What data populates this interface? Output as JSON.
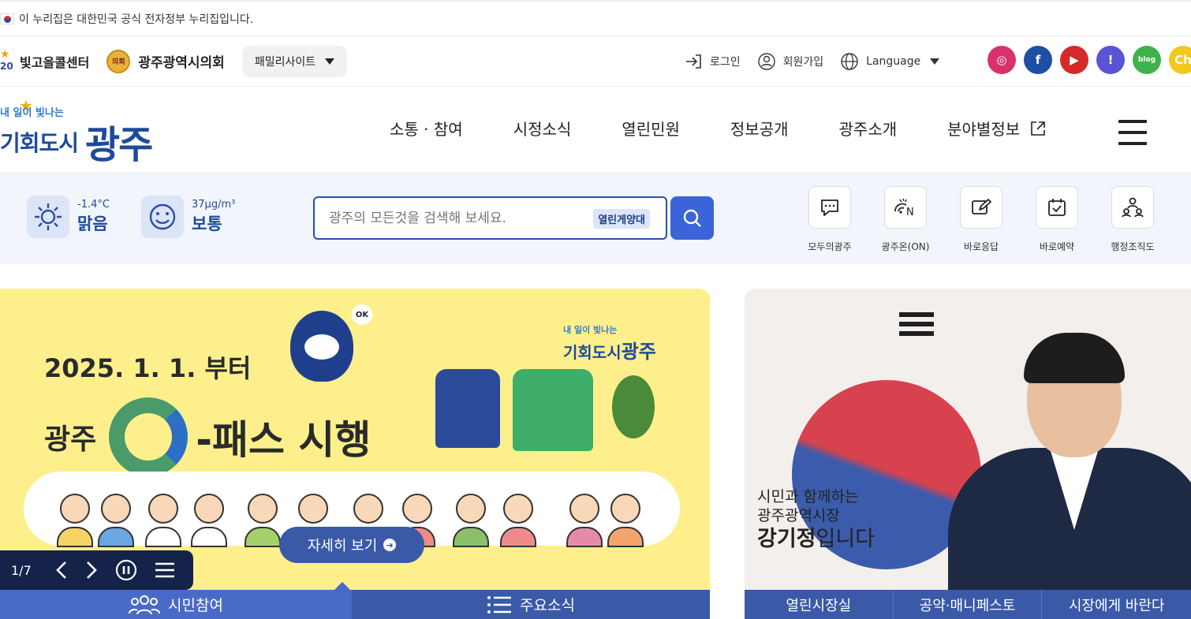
{
  "gov_banner": {
    "text": "이 누리집은 대한민국 공식 전자정부 누리집입니다."
  },
  "utility": {
    "callcenter_label": "빛고을콜센터",
    "council_label": "광주광역시의회",
    "council_seal_text": "의회",
    "family_site_label": "패밀리사이트",
    "login_label": "로그인",
    "signup_label": "회원가입",
    "language_label": "Language",
    "sns": [
      {
        "name": "instagram-icon",
        "glyph": "◎",
        "color": "#d6336c"
      },
      {
        "name": "facebook-icon",
        "glyph": "f",
        "color": "#1d4fa3"
      },
      {
        "name": "youtube-icon",
        "glyph": "▶",
        "color": "#d62929"
      },
      {
        "name": "channel-icon",
        "glyph": "!",
        "color": "#5b53d6"
      },
      {
        "name": "blog-icon",
        "glyph": "blog",
        "color": "#3fb24a"
      },
      {
        "name": "kakao-channel-icon",
        "glyph": "Ch",
        "color": "#f2c81c"
      }
    ]
  },
  "main_logo": {
    "small": "내 일이 빛나는",
    "mid": "기회도시",
    "big": "광주"
  },
  "nav": {
    "items": [
      "소통 · 참여",
      "시정소식",
      "열린민원",
      "정보공개",
      "광주소개",
      "분야별정보"
    ]
  },
  "weather": {
    "temp": "-1.4°C",
    "condition": "맑음",
    "dust_value": "37μg/m³",
    "dust_status": "보통"
  },
  "search": {
    "placeholder": "광주의 모든것을 검색해 보세요.",
    "tag": "열린게양대"
  },
  "quick_links": [
    "모두의광주",
    "광주온(ON)",
    "바로응답",
    "바로예약",
    "행정조직도"
  ],
  "hero": {
    "date": "2025. 1. 1. 부터",
    "prefix": "광주",
    "title": "-패스 시행",
    "city_small": "내 일이 빛나는",
    "city_mid": "기회도시",
    "city_big": "광주",
    "ok": "OK",
    "detail_label": "자세히 보기",
    "counter": "1/7",
    "tabs": [
      "시민참여",
      "주요소식"
    ],
    "colors": {
      "bg": "#fdf08c",
      "tab_active": "#4a6ac8",
      "tab_inactive": "#3a5aa8"
    }
  },
  "mayor": {
    "line1": "시민과 함께하는",
    "line2": "광주광역시장",
    "name": "강기정",
    "suffix": "입니다",
    "tabs": [
      "열린시장실",
      "공약·매니페스토",
      "시장에게 바란다"
    ]
  }
}
